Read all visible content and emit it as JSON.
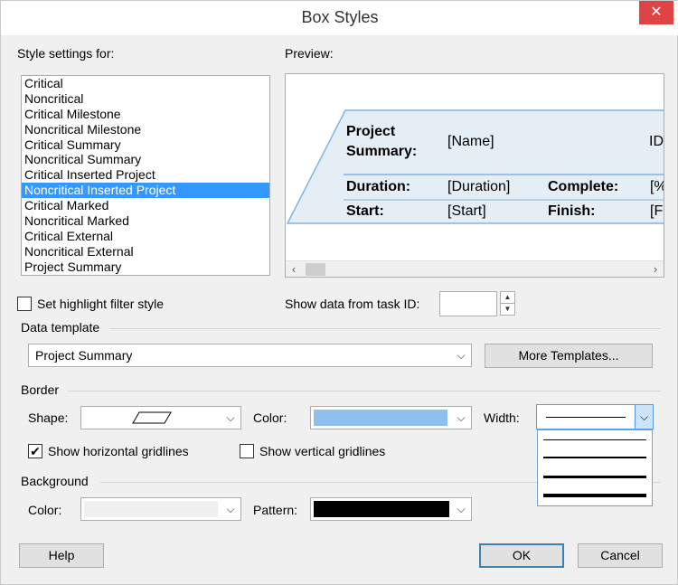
{
  "window": {
    "title": "Box Styles",
    "close_glyph": "✕"
  },
  "style_settings": {
    "label": "Style settings for:",
    "items": [
      "Critical",
      "Noncritical",
      "Critical Milestone",
      "Noncritical Milestone",
      "Critical Summary",
      "Noncritical Summary",
      "Critical Inserted Project",
      "Noncritical Inserted Project",
      "Critical Marked",
      "Noncritical Marked",
      "Critical External",
      "Noncritical External",
      "Project Summary"
    ],
    "selected_index": 7
  },
  "preview": {
    "label": "Preview:",
    "project_label": "Project",
    "summary_label": "Summary:",
    "name_field": "[Name]",
    "id_field": "ID",
    "duration_label": "Duration:",
    "duration_field": "[Duration]",
    "complete_label": "Complete:",
    "complete_field": "[%",
    "start_label": "Start:",
    "start_field": "[Start]",
    "finish_label": "Finish:",
    "finish_field": "[Fi",
    "box_border_color": "#7eb4e6"
  },
  "highlight": {
    "label": "Set highlight filter style",
    "checked": false
  },
  "task_id": {
    "label": "Show data from task ID:",
    "value": ""
  },
  "data_template": {
    "group_label": "Data template",
    "value": "Project Summary",
    "more_button": "More Templates..."
  },
  "border": {
    "group_label": "Border",
    "shape_label": "Shape:",
    "color_label": "Color:",
    "color_value": "#8fbfef",
    "width_label": "Width:",
    "show_horizontal_label": "Show horizontal gridlines",
    "show_horizontal_checked": true,
    "show_vertical_label": "Show vertical gridlines",
    "show_vertical_checked": false
  },
  "background": {
    "group_label": "Background",
    "color_label": "Color:",
    "color_value": "#f0f0f0",
    "pattern_label": "Pattern:",
    "pattern_value": "#000000"
  },
  "buttons": {
    "help": "Help",
    "ok": "OK",
    "cancel": "Cancel"
  },
  "icons": {
    "dropdown": "chevron-down-icon",
    "check": "✔"
  }
}
